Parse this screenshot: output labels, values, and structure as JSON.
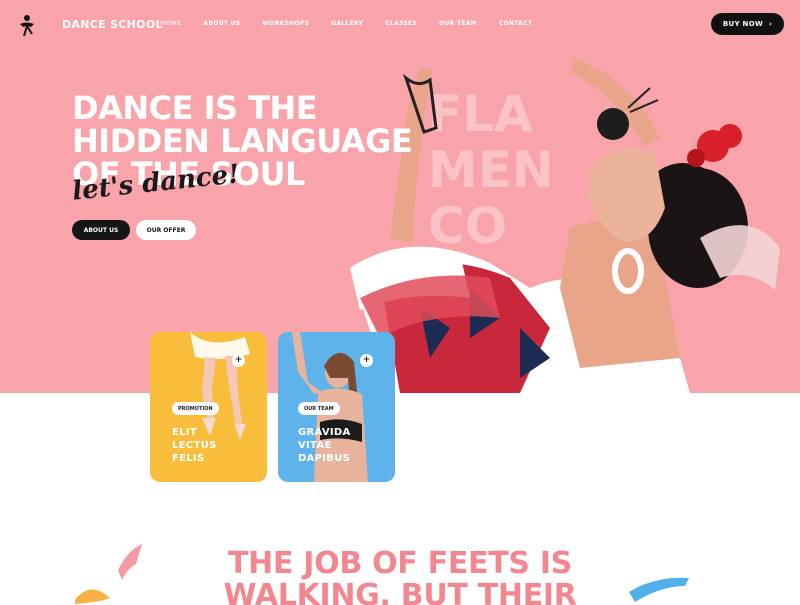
{
  "header": {
    "brand": "DANCE SCHOOL",
    "nav": [
      "HOME",
      "ABOUT US",
      "WORKSHOPS",
      "GALLERY",
      "CLASSES",
      "OUR TEAM",
      "CONTACT"
    ],
    "cta": "BUY NOW",
    "cta_icon": "›"
  },
  "hero": {
    "headline": [
      "DANCE IS THE",
      "HIDDEN LANGUAGE",
      "OF THE SOUL"
    ],
    "script": "let's dance!",
    "buttons": {
      "primary": "ABOUT US",
      "secondary": "OUR OFFER"
    },
    "watermark": [
      "FLA",
      "MEN",
      "CO"
    ]
  },
  "cards": [
    {
      "tag": "PROMOTION",
      "title": [
        "ELIT",
        "LECTUS",
        "FELIS"
      ],
      "plus": "+"
    },
    {
      "tag": "OUR TEAM",
      "title": [
        "GRAVIDA",
        "VITAE",
        "DAPIBUS"
      ],
      "plus": "+"
    }
  ],
  "section": {
    "tagline": [
      "THE JOB OF FEETS IS",
      "WALKING, BUT THEIR"
    ]
  },
  "colors": {
    "hero_bg": "#f9a3aa",
    "dark": "#111111",
    "card_yellow": "#f7bd3b",
    "card_blue": "#5eb3ea",
    "tagline": "#f3878f"
  }
}
